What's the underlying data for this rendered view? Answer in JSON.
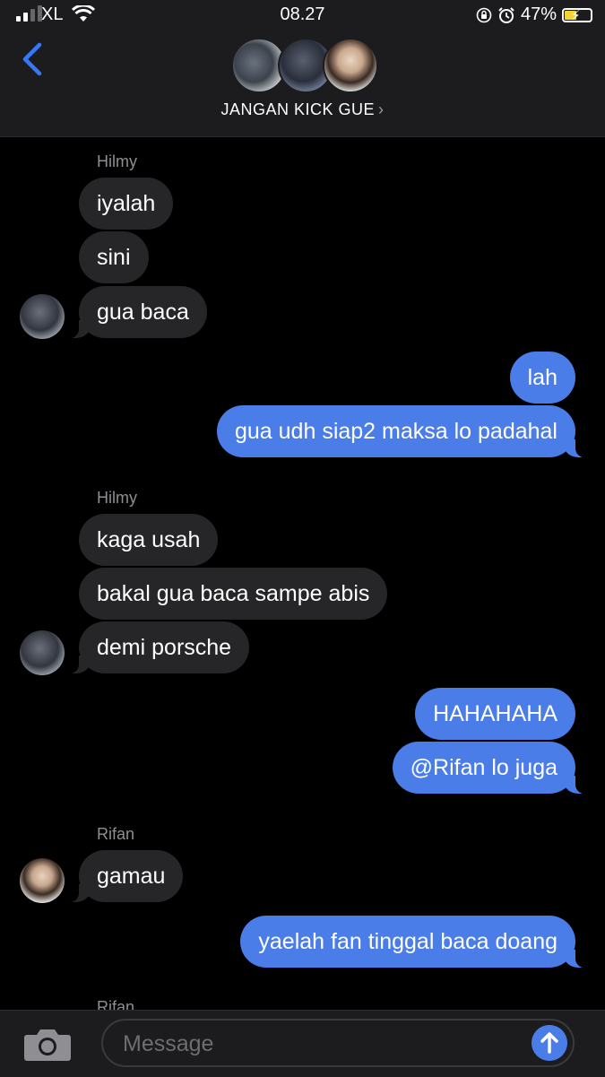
{
  "status_bar": {
    "carrier": "XL",
    "time": "08.27",
    "battery": "47%",
    "battery_level": 0.47
  },
  "header": {
    "group_name": "JANGAN KICK GUE",
    "chevron": "›"
  },
  "messages": [
    {
      "sender": "Hilmy"
    },
    {
      "text": "iyalah"
    },
    {
      "text": "sini"
    },
    {
      "text": "gua baca"
    },
    {
      "text": "lah"
    },
    {
      "text": "gua udh siap2 maksa lo padahal"
    },
    {
      "sender": "Hilmy"
    },
    {
      "text": "kaga usah"
    },
    {
      "text": "bakal gua baca sampe abis"
    },
    {
      "text": "demi porsche"
    },
    {
      "text": "HAHAHAHA"
    },
    {
      "text": "@Rifan lo juga"
    },
    {
      "sender": "Rifan"
    },
    {
      "text": "gamau"
    },
    {
      "text": "yaelah fan tinggal baca doang"
    },
    {
      "sender": "Rifan"
    }
  ],
  "input": {
    "placeholder": "Message"
  },
  "colors": {
    "outgoing_bubble": "#4a7de8",
    "incoming_bubble": "#262628",
    "accent": "#3478f6"
  }
}
